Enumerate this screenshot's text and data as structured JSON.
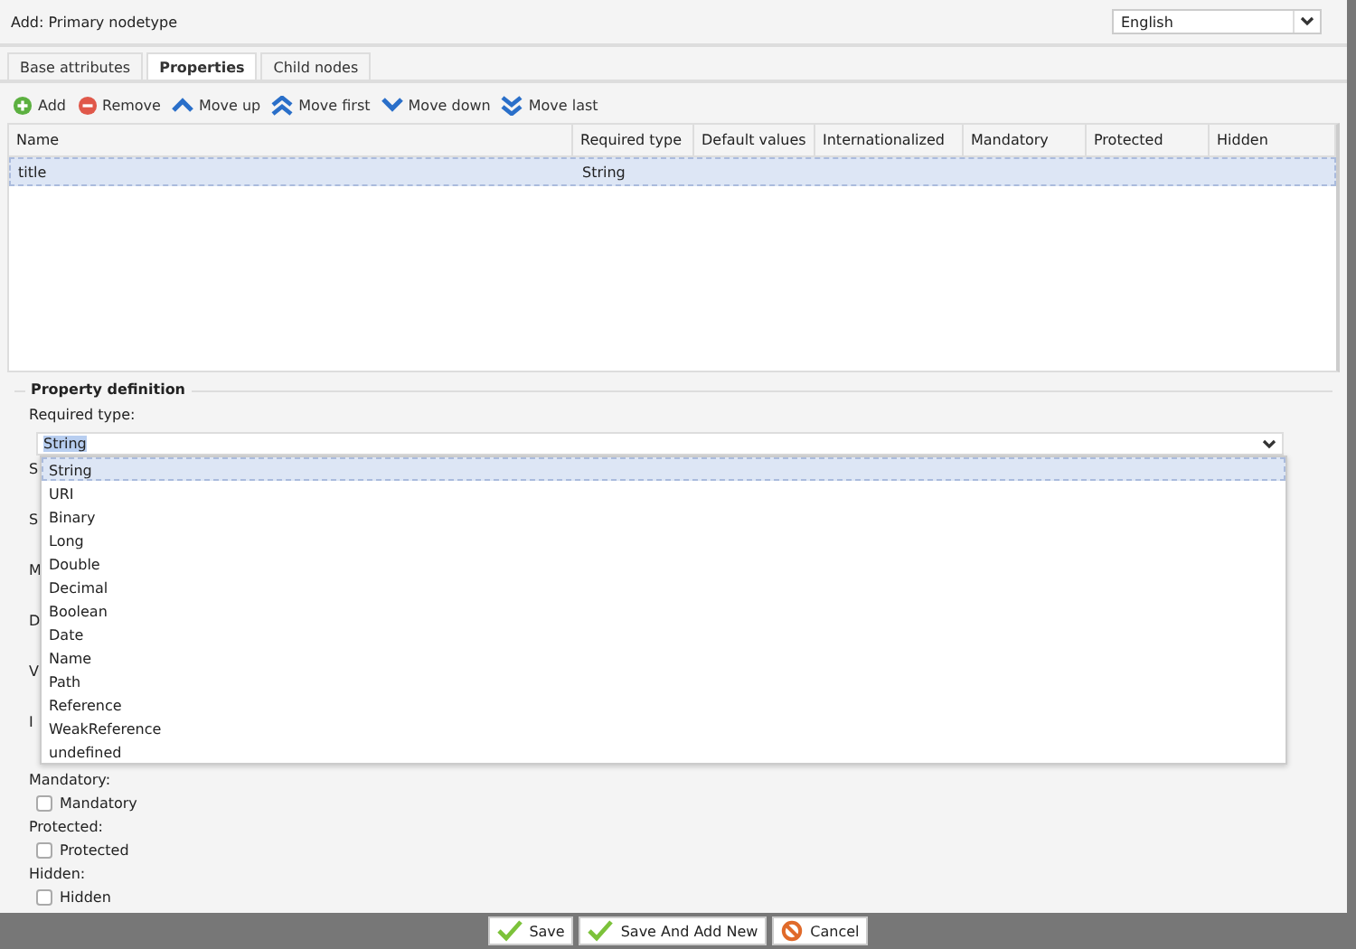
{
  "window": {
    "title": "Add: Primary nodetype"
  },
  "language": {
    "value": "English"
  },
  "tabs": [
    {
      "label": "Base attributes",
      "selected": false
    },
    {
      "label": "Properties",
      "selected": true
    },
    {
      "label": "Child nodes",
      "selected": false
    }
  ],
  "toolbar": [
    {
      "kind": "add",
      "label": "Add"
    },
    {
      "kind": "remove",
      "label": "Remove"
    },
    {
      "kind": "up",
      "label": "Move up"
    },
    {
      "kind": "first",
      "label": "Move first"
    },
    {
      "kind": "down",
      "label": "Move down"
    },
    {
      "kind": "last",
      "label": "Move last"
    }
  ],
  "table": {
    "columns": [
      "Name",
      "Required type",
      "Default values",
      "Internationalized",
      "Mandatory",
      "Protected",
      "Hidden"
    ],
    "rows": [
      {
        "name": "title",
        "required_type": "String",
        "selected": true
      }
    ]
  },
  "property_definition": {
    "legend": "Property definition",
    "required_type": {
      "label": "Required type:",
      "value": "String",
      "options": [
        {
          "label": "String",
          "selected": true
        },
        {
          "label": "URI",
          "selected": false
        },
        {
          "label": "Binary",
          "selected": false
        },
        {
          "label": "Long",
          "selected": false
        },
        {
          "label": "Double",
          "selected": false
        },
        {
          "label": "Decimal",
          "selected": false
        },
        {
          "label": "Boolean",
          "selected": false
        },
        {
          "label": "Date",
          "selected": false
        },
        {
          "label": "Name",
          "selected": false
        },
        {
          "label": "Path",
          "selected": false
        },
        {
          "label": "Reference",
          "selected": false
        },
        {
          "label": "WeakReference",
          "selected": false
        },
        {
          "label": "undefined",
          "selected": false
        }
      ]
    },
    "covered_labels": [
      "S",
      "S",
      "M",
      "D",
      "V",
      "I"
    ],
    "checkboxes": [
      {
        "label": "Mandatory:",
        "text": "Mandatory",
        "checked": false
      },
      {
        "label": "Protected:",
        "text": "Protected",
        "checked": false
      },
      {
        "label": "Hidden:",
        "text": "Hidden",
        "checked": false
      }
    ]
  },
  "buttons": [
    {
      "kind": "save",
      "label": "Save"
    },
    {
      "kind": "save",
      "label": "Save And Add New"
    },
    {
      "kind": "cancel",
      "label": "Cancel"
    }
  ]
}
